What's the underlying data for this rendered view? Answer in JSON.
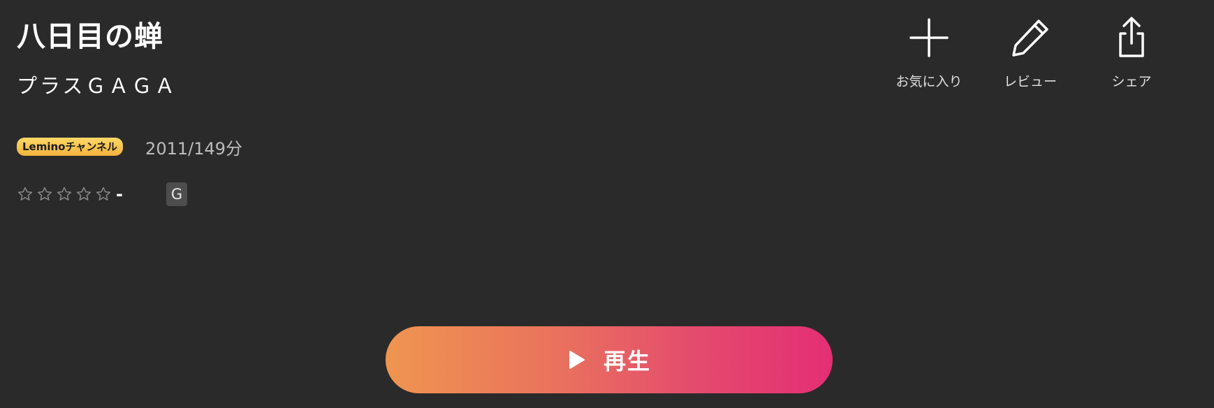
{
  "title": "八日目の蝉",
  "studio": "プラスＧＡＧＡ",
  "meta": {
    "channel_badge": "Leminoチャンネル",
    "year_length": "2011/149分"
  },
  "rating": {
    "stars_filled": 0,
    "stars_total": 5,
    "value": "-",
    "age_rating": "G"
  },
  "actions": [
    {
      "label": "お気に入り",
      "icon": "plus-icon"
    },
    {
      "label": "レビュー",
      "icon": "pencil-icon"
    },
    {
      "label": "シェア",
      "icon": "share-icon"
    }
  ],
  "play": {
    "label": "再生",
    "icon": "play-icon"
  },
  "colors": {
    "background": "#2a2a2a",
    "badge": "#f3b33d",
    "play_gradient_start": "#ef9550",
    "play_gradient_end": "#e42e74",
    "star_outline": "#8a8a8a"
  }
}
